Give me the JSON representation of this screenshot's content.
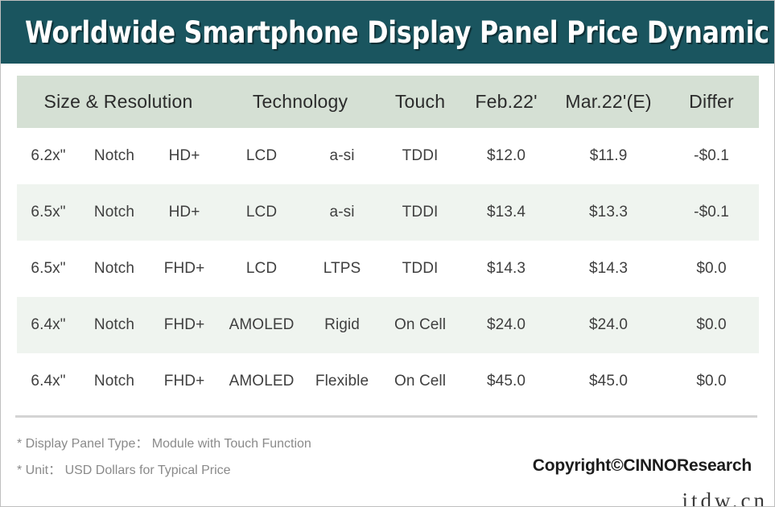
{
  "title": "Worldwide Smartphone Display Panel Price Dynamic",
  "table": {
    "headers": {
      "size_resolution": "Size & Resolution",
      "technology": "Technology",
      "touch": "Touch",
      "feb": "Feb.22'",
      "mar": "Mar.22'(E)",
      "differ": "Differ"
    },
    "rows": [
      {
        "size": "6.2x\"",
        "notch": "Notch",
        "resolution": "HD+",
        "tech": "LCD",
        "backplane": "a-si",
        "touch": "TDDI",
        "feb": "$12.0",
        "mar": "$11.9",
        "differ": "-$0.1"
      },
      {
        "size": "6.5x\"",
        "notch": "Notch",
        "resolution": "HD+",
        "tech": "LCD",
        "backplane": "a-si",
        "touch": "TDDI",
        "feb": "$13.4",
        "mar": "$13.3",
        "differ": "-$0.1"
      },
      {
        "size": "6.5x\"",
        "notch": "Notch",
        "resolution": "FHD+",
        "tech": "LCD",
        "backplane": "LTPS",
        "touch": "TDDI",
        "feb": "$14.3",
        "mar": "$14.3",
        "differ": "$0.0"
      },
      {
        "size": "6.4x\"",
        "notch": "Notch",
        "resolution": "FHD+",
        "tech": "AMOLED",
        "backplane": "Rigid",
        "touch": "On Cell",
        "feb": "$24.0",
        "mar": "$24.0",
        "differ": "$0.0"
      },
      {
        "size": "6.4x\"",
        "notch": "Notch",
        "resolution": "FHD+",
        "tech": "AMOLED",
        "backplane": "Flexible",
        "touch": "On Cell",
        "feb": "$45.0",
        "mar": "$45.0",
        "differ": "$0.0"
      }
    ]
  },
  "footer": {
    "note_1": "* Display Panel Type： Module with Touch Function",
    "note_2": "* Unit： USD Dollars for Typical Price",
    "copyright": "Copyright©CINNOResearch"
  },
  "watermark": "itdw.cn",
  "colors": {
    "banner": "#1a555f",
    "header_row": "#d5e0d4",
    "alt_row": "#eff4ef",
    "base_row": "#ffffff",
    "body_text": "#3f3f3f",
    "note_text": "#8a8a8a",
    "divider": "#d4d4d4"
  }
}
